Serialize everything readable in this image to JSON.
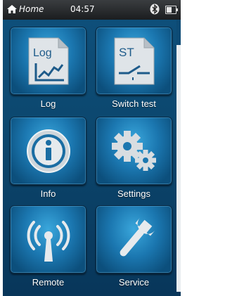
{
  "status_bar": {
    "home_label": "Home",
    "time": "04:57",
    "battery_level": 0.6
  },
  "tiles": [
    {
      "label": "Log",
      "icon": "log-document-icon",
      "doc_text": "Log"
    },
    {
      "label": "Switch test",
      "icon": "switch-test-document-icon",
      "doc_text": "ST"
    },
    {
      "label": "Info",
      "icon": "info-icon"
    },
    {
      "label": "Settings",
      "icon": "gears-icon"
    },
    {
      "label": "Remote",
      "icon": "antenna-icon"
    },
    {
      "label": "Service",
      "icon": "wrench-icon"
    }
  ],
  "colors": {
    "background": "#0c476e",
    "tile_highlight": "#3aa7dc",
    "tile_base": "#1b77b0"
  }
}
